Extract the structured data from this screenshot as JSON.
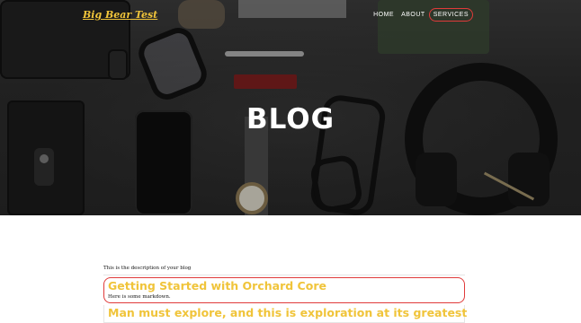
{
  "navbar": {
    "brand": "Big Bear Test",
    "links": [
      {
        "label": "HOME"
      },
      {
        "label": "ABOUT"
      },
      {
        "label": "SERVICES"
      }
    ]
  },
  "hero": {
    "title": "BLOG"
  },
  "main": {
    "description": "This is the description of your blog",
    "posts": [
      {
        "title": "Getting Started with Orchard Core",
        "excerpt": "Here is some markdown."
      },
      {
        "title": "Man must explore, and this is exploration at its greatest",
        "excerpt": ""
      }
    ]
  },
  "colors": {
    "accent": "#f0c43a",
    "highlight": "#e03a3a"
  }
}
